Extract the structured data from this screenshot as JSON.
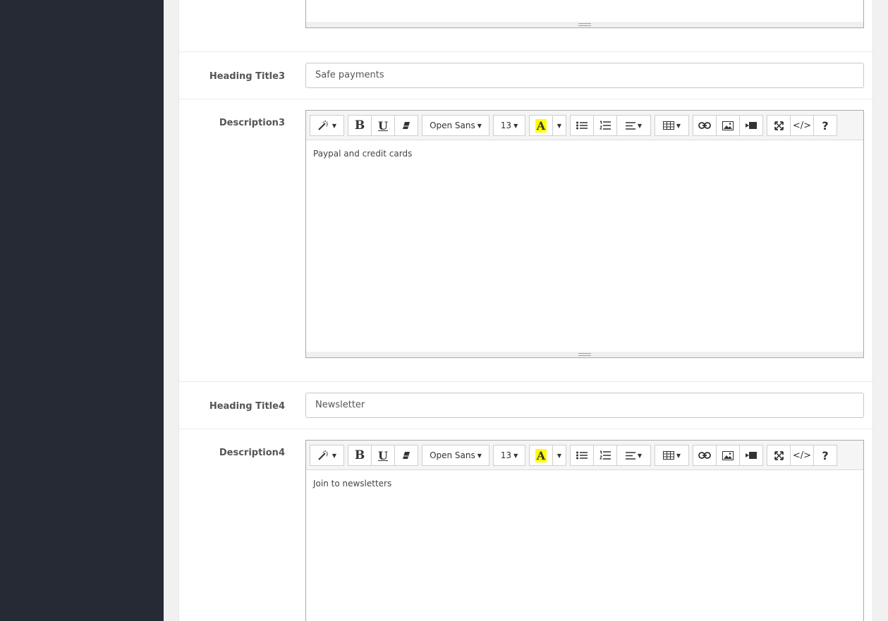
{
  "fields": {
    "heading3": {
      "label": "Heading Title3",
      "value": "Safe payments"
    },
    "description3": {
      "label": "Description3",
      "content": "Paypal and credit cards"
    },
    "heading4": {
      "label": "Heading Title4",
      "value": "Newsletter"
    },
    "description4": {
      "label": "Description4",
      "content": "Join to newsletters"
    }
  },
  "toolbar": {
    "font_family": "Open Sans",
    "font_size": "13",
    "color_letter": "A",
    "highlight_color": "#ffff00",
    "icons": [
      "magic-icon",
      "bold-icon",
      "underline-icon",
      "eraser-icon",
      "font-family-dropdown",
      "font-size-dropdown",
      "text-color-icon",
      "color-dropdown-icon",
      "unordered-list-icon",
      "ordered-list-icon",
      "align-icon",
      "table-icon",
      "link-icon",
      "picture-icon",
      "video-icon",
      "fullscreen-icon",
      "code-view-icon",
      "help-icon"
    ]
  }
}
